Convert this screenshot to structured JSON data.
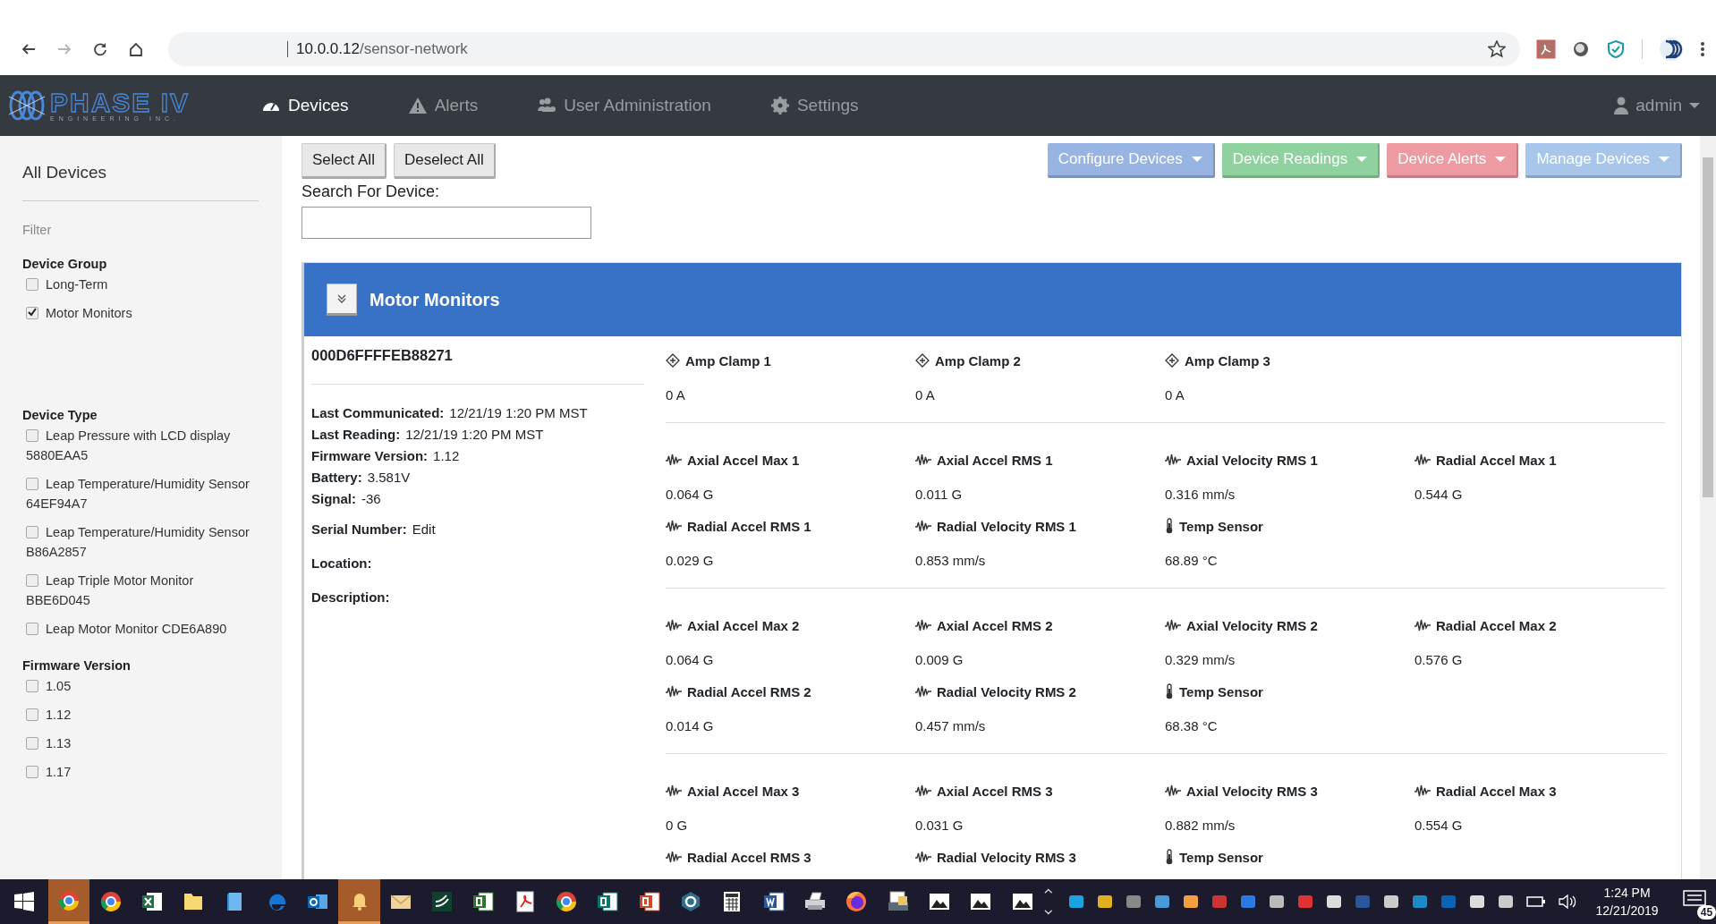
{
  "browser": {
    "nav_buttons": [
      {
        "kind": "back",
        "disabled": false
      },
      {
        "kind": "forward",
        "disabled": true
      },
      {
        "kind": "reload",
        "disabled": false
      },
      {
        "kind": "home",
        "disabled": false
      }
    ],
    "url_host": "10.0.0.12",
    "url_path": "/sensor-network"
  },
  "navbar": {
    "logo_title": "PHASE IV",
    "logo_subtitle": "ENGINEERING INC.",
    "items": [
      {
        "label": "Devices",
        "selected": true
      },
      {
        "label": "Alerts",
        "selected": false
      },
      {
        "label": "User Administration",
        "selected": false
      },
      {
        "label": "Settings",
        "selected": false
      }
    ],
    "user": "admin"
  },
  "sidebar": {
    "title": "All Devices",
    "filter_label": "Filter",
    "sections": [
      {
        "title": "Device Group",
        "items": [
          {
            "label": "Long-Term",
            "checked": false
          },
          {
            "label": "Motor Monitors",
            "checked": true
          }
        ]
      },
      {
        "title": "Device Type",
        "items": [
          {
            "label": "Leap Pressure with LCD display 5880EAA5",
            "checked": false
          },
          {
            "label": "Leap Temperature/Humidity Sensor 64EF94A7",
            "checked": false
          },
          {
            "label": "Leap Temperature/Humidity Sensor B86A2857",
            "checked": false
          },
          {
            "label": "Leap Triple Motor Monitor BBE6D045",
            "checked": false
          },
          {
            "label": "Leap Motor Monitor CDE6A890",
            "checked": false
          }
        ]
      },
      {
        "title": "Firmware Version",
        "items": [
          {
            "label": "1.05",
            "checked": false
          },
          {
            "label": "1.12",
            "checked": false
          },
          {
            "label": "1.13",
            "checked": false
          },
          {
            "label": "1.17",
            "checked": false
          }
        ]
      }
    ]
  },
  "toolbar": {
    "buttons": [
      "Select All",
      "Deselect All"
    ],
    "search_label": "Search For Device:",
    "actions": [
      {
        "label": "Configure Devices",
        "color": "#97b4e2"
      },
      {
        "label": "Device Readings",
        "color": "#8fd29f"
      },
      {
        "label": "Device Alerts",
        "color": "#ee9aa3"
      },
      {
        "label": "Manage Devices",
        "color": "#a8c6ec"
      }
    ]
  },
  "panel": {
    "title": "Motor Monitors",
    "device_id": "000D6FFFFEB88271",
    "info": [
      {
        "label": "Last Communicated:",
        "value": "12/21/19 1:20 PM  MST"
      },
      {
        "label": "Last Reading:",
        "value": "12/21/19 1:20 PM  MST"
      },
      {
        "label": "Firmware Version:",
        "value": "1.12"
      },
      {
        "label": "Battery:",
        "value": "3.581V"
      },
      {
        "label": "Signal:",
        "value": "-36"
      },
      {
        "label": "Serial Number:",
        "value": "Edit"
      },
      {
        "label": "Location:"
      },
      {
        "label": "Description:"
      }
    ],
    "reading_groups": [
      [
        {
          "kind": "clamp",
          "label": "Amp Clamp 1",
          "value": "0 A"
        },
        {
          "kind": "clamp",
          "label": "Amp Clamp 2",
          "value": "0 A"
        },
        {
          "kind": "clamp",
          "label": "Amp Clamp 3",
          "value": "0 A"
        }
      ],
      [
        {
          "kind": "wave",
          "label": "Axial Accel Max 1",
          "value": "0.064 G"
        },
        {
          "kind": "wave",
          "label": "Axial Accel RMS 1",
          "value": "0.011 G"
        },
        {
          "kind": "wave",
          "label": "Axial Velocity RMS 1",
          "value": "0.316 mm/s"
        },
        {
          "kind": "wave",
          "label": "Radial Accel Max 1",
          "value": "0.544 G"
        },
        {
          "kind": "wave",
          "label": "Radial Accel RMS 1",
          "value": "0.029 G"
        },
        {
          "kind": "wave",
          "label": "Radial Velocity RMS 1",
          "value": "0.853 mm/s"
        },
        {
          "kind": "thermometer",
          "label": "Temp Sensor",
          "value": "68.89 °C"
        }
      ],
      [
        {
          "kind": "wave",
          "label": "Axial Accel Max 2",
          "value": "0.064 G"
        },
        {
          "kind": "wave",
          "label": "Axial Accel RMS 2",
          "value": "0.009 G"
        },
        {
          "kind": "wave",
          "label": "Axial Velocity RMS 2",
          "value": "0.329 mm/s"
        },
        {
          "kind": "wave",
          "label": "Radial Accel Max 2",
          "value": "0.576 G"
        },
        {
          "kind": "wave",
          "label": "Radial Accel RMS 2",
          "value": "0.014 G"
        },
        {
          "kind": "wave",
          "label": "Radial Velocity RMS 2",
          "value": "0.457 mm/s"
        },
        {
          "kind": "thermometer",
          "label": "Temp Sensor",
          "value": "68.38 °C"
        }
      ],
      [
        {
          "kind": "wave",
          "label": "Axial Accel Max 3",
          "value": "0 G"
        },
        {
          "kind": "wave",
          "label": "Axial Accel RMS 3",
          "value": "0.031 G"
        },
        {
          "kind": "wave",
          "label": "Axial Velocity RMS 3",
          "value": "0.882 mm/s"
        },
        {
          "kind": "wave",
          "label": "Radial Accel Max 3",
          "value": "0.554 G"
        },
        {
          "kind": "wave",
          "label": "Radial Accel RMS 3"
        },
        {
          "kind": "wave",
          "label": "Radial Velocity RMS 3"
        },
        {
          "kind": "thermometer",
          "label": "Temp Sensor"
        }
      ]
    ]
  },
  "taskbar": {
    "apps": [
      {
        "kind": "browser",
        "active": true
      },
      {
        "kind": "browser",
        "active": false
      },
      {
        "kind": "spreadsheet",
        "active": false
      },
      {
        "kind": "folder",
        "active": false
      },
      {
        "kind": "box",
        "active": false
      },
      {
        "kind": "edge",
        "active": false
      },
      {
        "kind": "mail",
        "active": false
      },
      {
        "kind": "bell",
        "active": true
      },
      {
        "kind": "envelope",
        "active": false
      },
      {
        "kind": "wave",
        "active": false
      },
      {
        "kind": "project",
        "active": false
      },
      {
        "kind": "pdf",
        "active": false
      },
      {
        "kind": "browser",
        "active": false
      },
      {
        "kind": "publisher",
        "active": false
      },
      {
        "kind": "slides",
        "active": false
      },
      {
        "kind": "gear",
        "active": false
      },
      {
        "kind": "calculator",
        "active": false
      },
      {
        "kind": "word",
        "active": false
      },
      {
        "kind": "printer",
        "active": false
      },
      {
        "kind": "fox",
        "active": false
      },
      {
        "kind": "scanner",
        "active": false
      },
      {
        "kind": "image",
        "active": false
      },
      {
        "kind": "image",
        "active": false
      },
      {
        "kind": "image",
        "active": false
      }
    ],
    "time": "1:24 PM",
    "date": "12/21/2019",
    "notification_count": "45"
  }
}
